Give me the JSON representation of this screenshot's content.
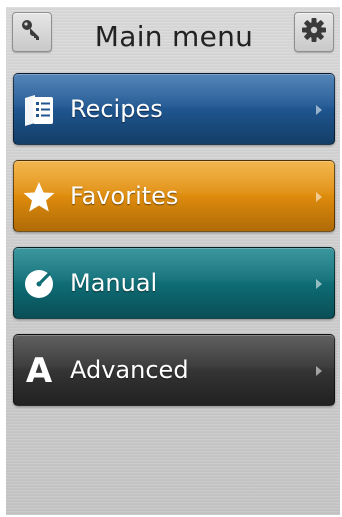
{
  "header": {
    "title": "Main menu",
    "left_button_icon": "key-icon",
    "right_button_icon": "gear-icon"
  },
  "menu": {
    "items": [
      {
        "label": "Recipes",
        "icon": "recipe-book-icon",
        "color": "#1f5690"
      },
      {
        "label": "Favorites",
        "icon": "star-icon",
        "color": "#de8c0c"
      },
      {
        "label": "Manual",
        "icon": "dial-icon",
        "color": "#0f6d76"
      },
      {
        "label": "Advanced",
        "icon": "letter-a-icon",
        "icon_text": "A",
        "color": "#353535"
      }
    ]
  }
}
